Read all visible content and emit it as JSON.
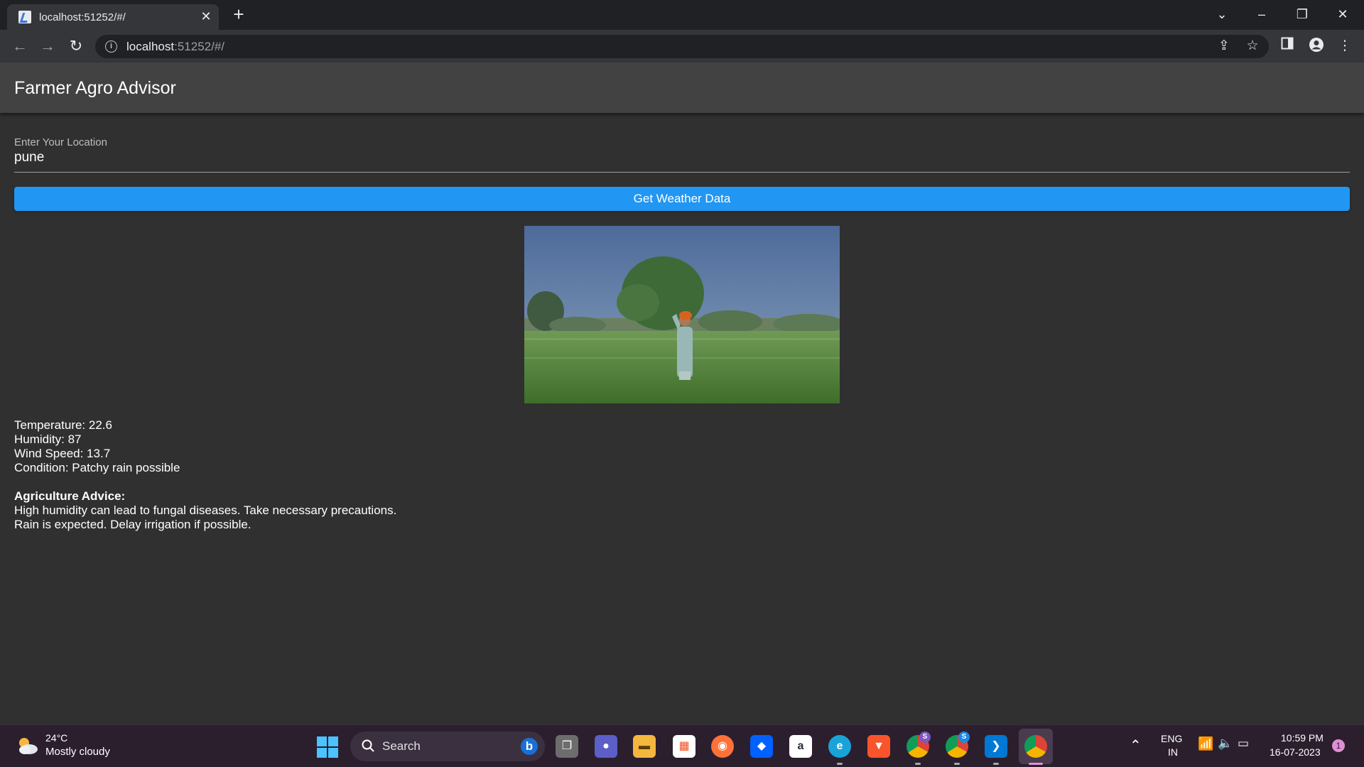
{
  "browser": {
    "tab_title": "localhost:51252/#/",
    "url_host": "localhost",
    "url_rest": ":51252/#/"
  },
  "app": {
    "title": "Farmer Agro Advisor",
    "location_label": "Enter Your Location",
    "location_value": "pune",
    "button_label": "Get Weather Data"
  },
  "weather": {
    "temperature": "Temperature: 22.6",
    "humidity": "Humidity: 87",
    "wind": "Wind Speed: 13.7",
    "condition": "Condition: Patchy rain possible"
  },
  "advice": {
    "heading": "Agriculture Advice:",
    "lines": [
      "High humidity can lead to fungal diseases. Take necessary precautions.",
      "Rain is expected. Delay irrigation if possible."
    ]
  },
  "taskbar": {
    "weather_temp": "24°C",
    "weather_condition": "Mostly cloudy",
    "search_label": "Search",
    "lang_top": "ENG",
    "lang_bottom": "IN",
    "time": "10:59 PM",
    "date": "16-07-2023",
    "notification_count": "1",
    "chrome_badge_1": "S",
    "chrome_badge_2": "S"
  },
  "colors": {
    "appbar": "#424242",
    "background": "#303030",
    "button": "#2196f3",
    "taskbar": "#2b1f2e"
  }
}
